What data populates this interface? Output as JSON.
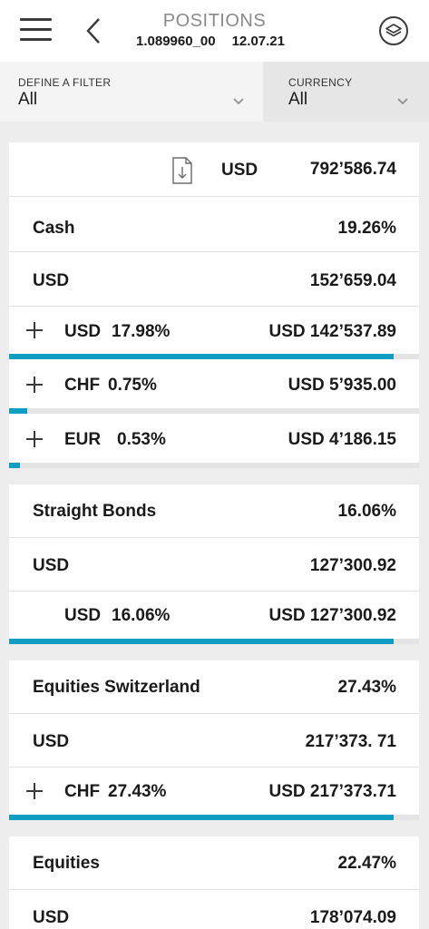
{
  "header": {
    "title": "POSITIONS",
    "account": "1.089960_00",
    "date": "12.07.21",
    "icons": [
      "hamburger-menu-icon",
      "back-chevron-icon",
      "layers-icon"
    ]
  },
  "filters": {
    "filter": {
      "label": "DEFINE A FILTER",
      "value": "All"
    },
    "currency": {
      "label": "CURRENCY",
      "value": "All"
    }
  },
  "total": {
    "currency": "USD",
    "amount": "792’586.74",
    "icon": "download-document-icon"
  },
  "colors": {
    "accent": "#0f9ec2",
    "background": "#ededed",
    "track": "#e4e4e4"
  },
  "sections": [
    {
      "name": "Cash",
      "percent": "19.26%",
      "subtotal": {
        "currency": "USD",
        "amount": "152’659.04"
      },
      "positions": [
        {
          "currency": "USD",
          "percent": "17.98%",
          "amount": "USD 142’537.89",
          "expandable": true,
          "fill": 0.937
        },
        {
          "currency": "CHF",
          "percent": "0.75%",
          "amount": "USD 5’935.00",
          "expandable": true,
          "fill": 0.044
        },
        {
          "currency": "EUR",
          "percent": "0.53%",
          "amount": "USD 4’186.15",
          "expandable": true,
          "fill": 0.027
        }
      ]
    },
    {
      "name": "Straight Bonds",
      "percent": "16.06%",
      "subtotal": {
        "currency": "USD",
        "amount": "127’300.92"
      },
      "positions": [
        {
          "currency": "USD",
          "percent": "16.06%",
          "amount": "USD 127’300.92",
          "expandable": false,
          "fill": 0.937
        }
      ]
    },
    {
      "name": "Equities Switzerland",
      "percent": "27.43%",
      "subtotal": {
        "currency": "USD",
        "amount": "217’373. 71"
      },
      "positions": [
        {
          "currency": "CHF",
          "percent": "27.43%",
          "amount": "USD 217’373.71",
          "expandable": true,
          "fill": 0.937
        }
      ]
    },
    {
      "name": "Equities",
      "percent": "22.47%",
      "subtotal": {
        "currency": "USD",
        "amount": "178’074.09"
      },
      "positions": []
    }
  ]
}
